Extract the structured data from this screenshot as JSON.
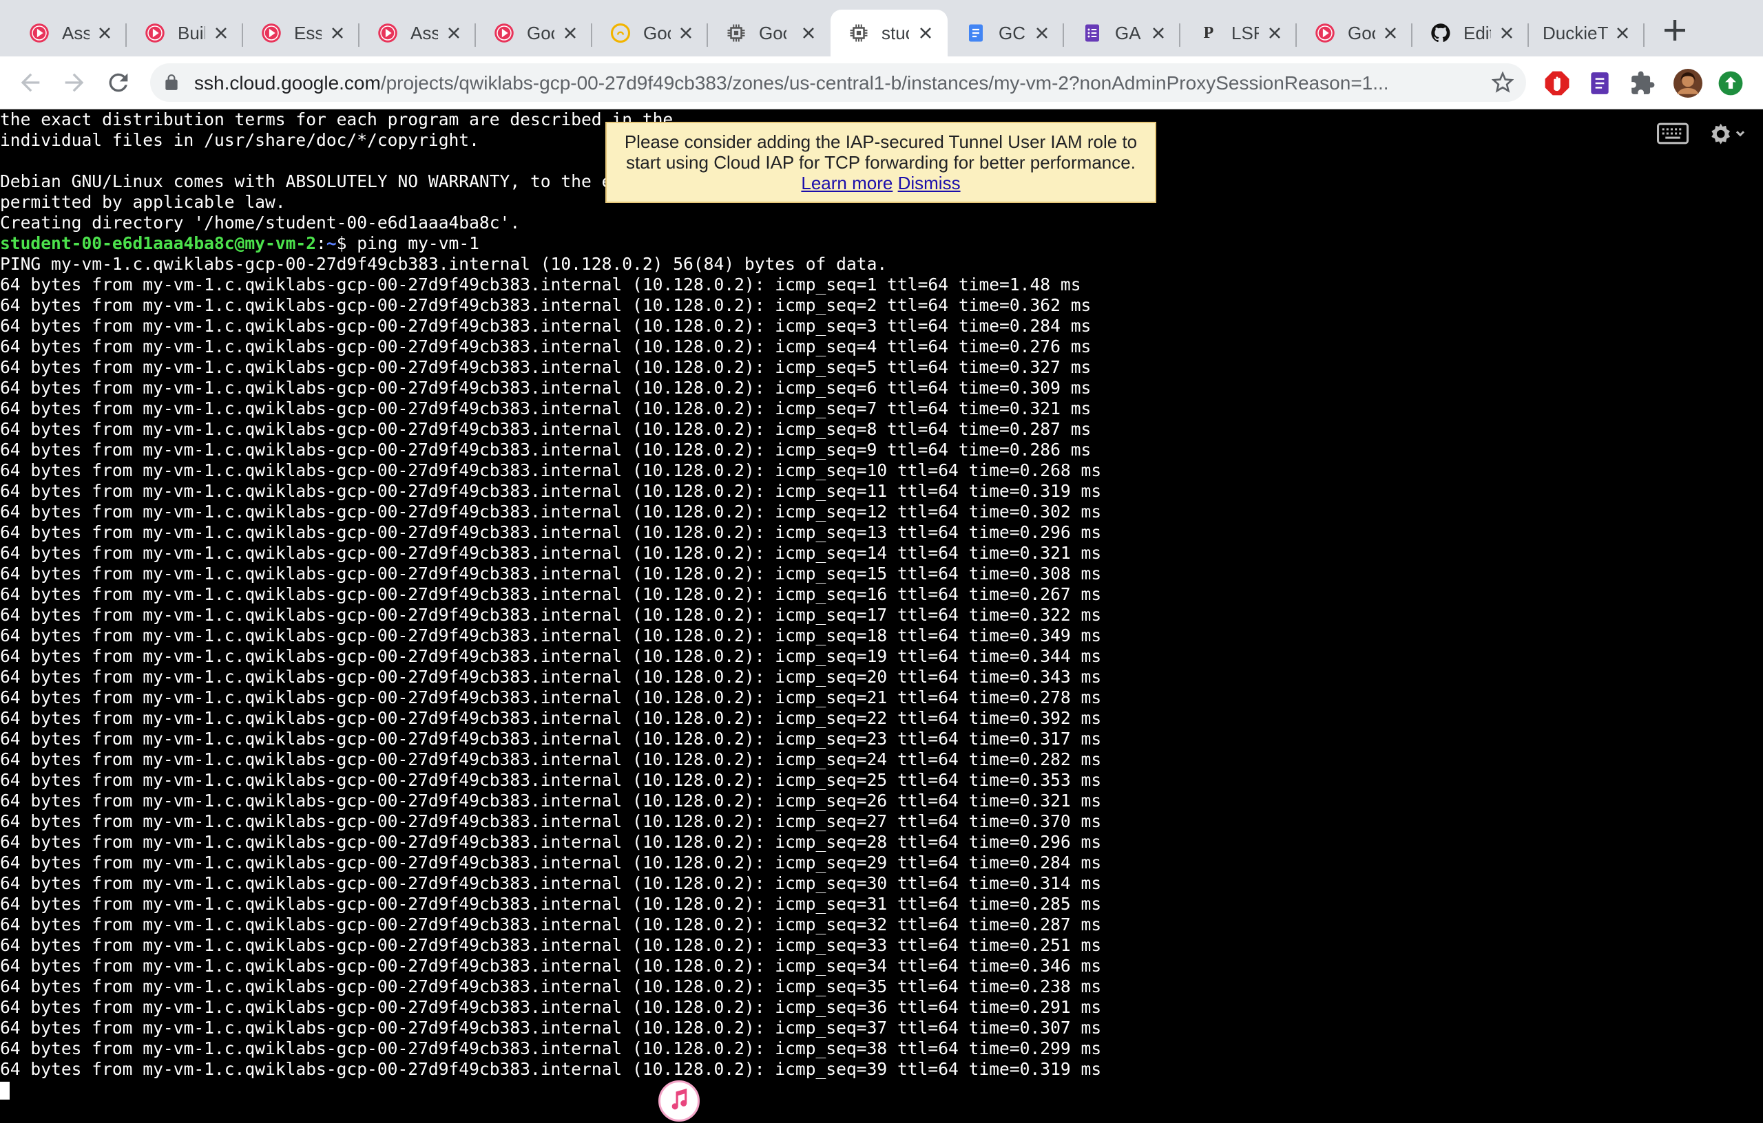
{
  "browser": {
    "tabs": [
      {
        "title": "Ass",
        "icon": "red-play-icon"
      },
      {
        "title": "Buil",
        "icon": "red-play-icon"
      },
      {
        "title": "Ess",
        "icon": "red-play-icon"
      },
      {
        "title": "Ass",
        "icon": "red-play-icon"
      },
      {
        "title": "Goo",
        "icon": "red-play-icon"
      },
      {
        "title": "Goo",
        "icon": "yellow-circle-icon"
      },
      {
        "title": "Goo",
        "icon": "chip-icon"
      },
      {
        "title": "stuc",
        "icon": "chip-icon"
      },
      {
        "title": "GCF",
        "icon": "docs-icon"
      },
      {
        "title": "GAI",
        "icon": "forms-icon"
      },
      {
        "title": "LSF",
        "icon": "p-icon",
        "icon_text": "P"
      },
      {
        "title": "Goo",
        "icon": "red-play-icon"
      },
      {
        "title": "Edit",
        "icon": "github-icon"
      },
      {
        "title": "DuckieT",
        "icon": "none"
      }
    ],
    "url": {
      "host": "ssh.cloud.google.com",
      "path": "/projects/qwiklabs-gcp-00-27d9f49cb383/zones/us-central1-b/instances/my-vm-2?nonAdminProxySessionReason=1..."
    }
  },
  "notice": {
    "text": "Please consider adding the IAP-secured Tunnel User IAM role to start using Cloud IAP for TCP forwarding for better performance.",
    "learn_more": "Learn more",
    "dismiss": "Dismiss"
  },
  "terminal": {
    "intro_lines": [
      "the exact distribution terms for each program are described in the",
      "individual files in /usr/share/doc/*/copyright.",
      "",
      "Debian GNU/Linux comes with ABSOLUTELY NO WARRANTY, to the extent",
      "permitted by applicable law.",
      "Creating directory '/home/student-00-e6d1aaa4ba8c'."
    ],
    "prompt": {
      "user_host": "student-00-e6d1aaa4ba8c@my-vm-2",
      "path": "~",
      "symbol": "$",
      "command": "ping my-vm-1"
    },
    "ping_header": "PING my-vm-1.c.qwiklabs-gcp-00-27d9f49cb383.internal (10.128.0.2) 56(84) bytes of data.",
    "reply_host": "my-vm-1.c.qwiklabs-gcp-00-27d9f49cb383.internal",
    "reply_ip": "10.128.0.2",
    "reply_bytes": 64,
    "ttl": 64,
    "ping_times_ms": [
      "1.48",
      "0.362",
      "0.284",
      "0.276",
      "0.327",
      "0.309",
      "0.321",
      "0.287",
      "0.286",
      "0.268",
      "0.319",
      "0.302",
      "0.296",
      "0.321",
      "0.308",
      "0.267",
      "0.322",
      "0.349",
      "0.344",
      "0.343",
      "0.278",
      "0.392",
      "0.317",
      "0.282",
      "0.353",
      "0.321",
      "0.370",
      "0.296",
      "0.284",
      "0.314",
      "0.285",
      "0.287",
      "0.251",
      "0.346",
      "0.238",
      "0.291",
      "0.307",
      "0.299",
      "0.319"
    ]
  },
  "colors": {
    "prompt_user": "#4ce24c",
    "prompt_path": "#5b80ff",
    "notice_bg": "#fbf0c0",
    "link": "#1a0dab"
  }
}
